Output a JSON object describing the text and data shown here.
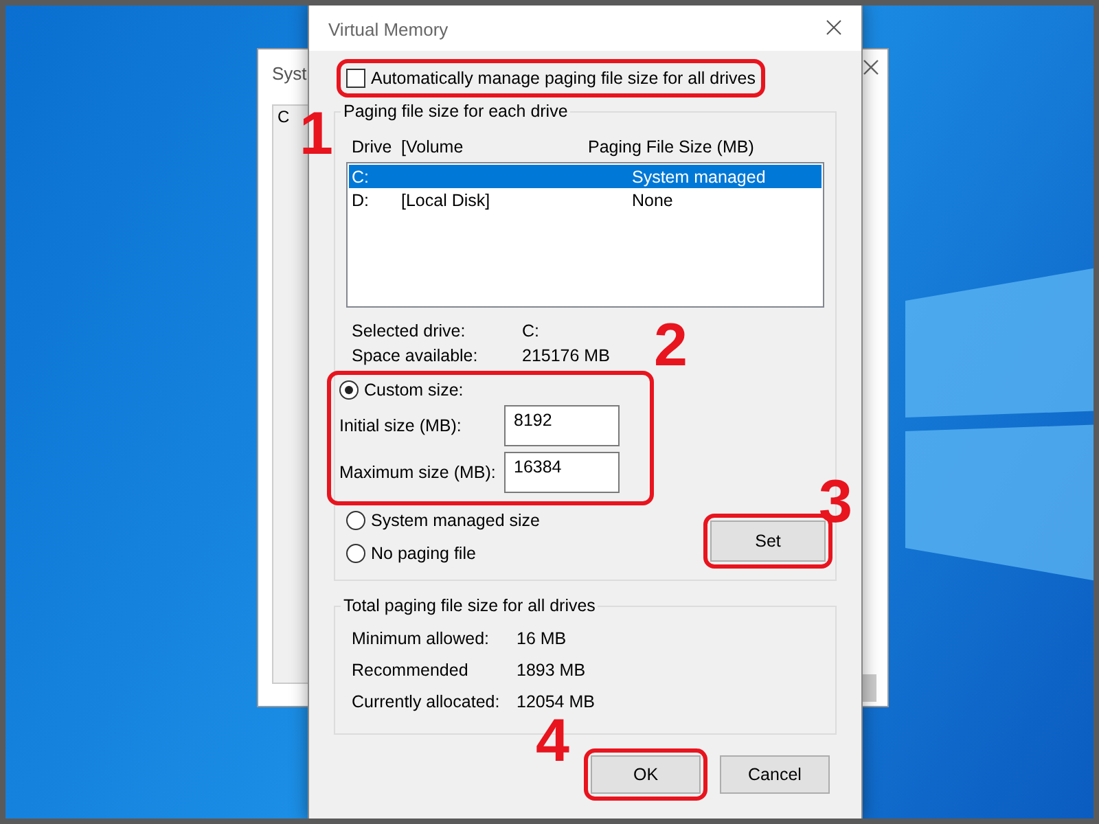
{
  "background_window": {
    "title": "Syst",
    "tab": "C"
  },
  "window": {
    "title": "Virtual Memory"
  },
  "auto_manage": {
    "label": "Automatically manage paging file size for all drives",
    "checked": false,
    "highlighted": true
  },
  "drives_group": {
    "title": "Paging file size for each drive",
    "columns": [
      "Drive",
      "[Volume",
      "Paging File Size (MB)"
    ],
    "rows": [
      {
        "drive": "C:",
        "size": "System managed",
        "selected": true
      },
      {
        "drive": "D:",
        "volume": "[Local Disk]",
        "size": "None",
        "selected": false
      }
    ]
  },
  "drive_info": [
    {
      "label": "Selected drive:",
      "value": "C:"
    },
    {
      "label": "Space available:",
      "value": "215176 MB"
    }
  ],
  "custom_size": {
    "label": "Custom size:",
    "selected": true,
    "highlighted": true,
    "fields": [
      {
        "label": "Initial size (MB):",
        "value": "8192"
      },
      {
        "label": "Maximum size (MB):",
        "value": "16384"
      }
    ]
  },
  "other_options": [
    {
      "label": "System managed size",
      "selected": false
    },
    {
      "label": "No paging file",
      "selected": false
    }
  ],
  "set_button": {
    "label": "Set",
    "highlighted": true
  },
  "totals": {
    "title": "Total paging file size for all drives",
    "rows": [
      {
        "label": "Minimum allowed:",
        "value": "16 MB"
      },
      {
        "label": "Recommended",
        "value": "1893 MB"
      },
      {
        "label": "Currently allocated:",
        "value": "12054 MB"
      }
    ]
  },
  "buttons": [
    {
      "label": "OK",
      "highlighted": true
    },
    {
      "label": "Cancel",
      "highlighted": false
    }
  ],
  "annotations": [
    "1",
    "2",
    "3",
    "4"
  ]
}
